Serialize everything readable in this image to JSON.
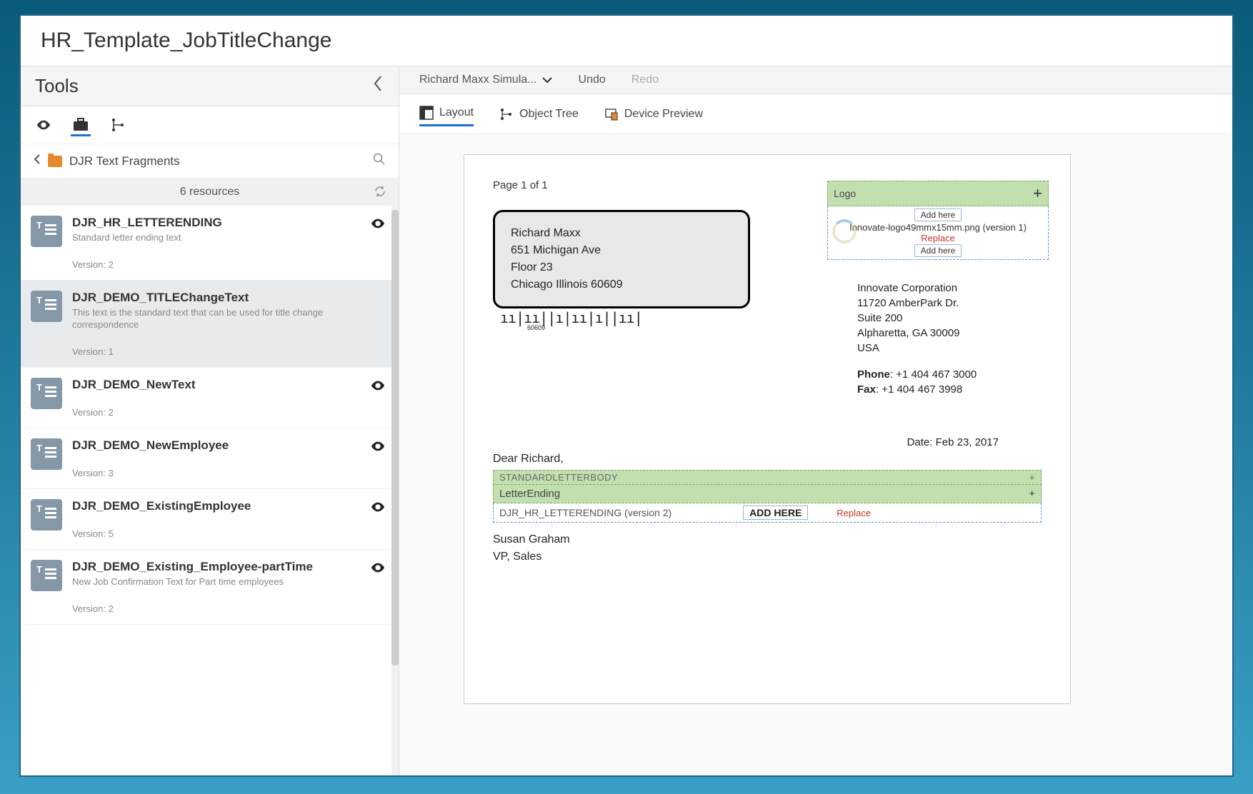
{
  "title": "HR_Template_JobTitleChange",
  "sidebar": {
    "tools_title": "Tools",
    "breadcrumb": "DJR Text Fragments",
    "count_label": "6 resources",
    "items": [
      {
        "title": "DJR_HR_LETTERENDING",
        "desc": "Standard letter ending text",
        "version": "Version: 2",
        "selected": false
      },
      {
        "title": "DJR_DEMO_TITLEChangeText",
        "desc": "This text is the standard text that can be used for title change correspondence",
        "version": "Version: 1",
        "selected": true
      },
      {
        "title": "DJR_DEMO_NewText",
        "desc": "",
        "version": "Version: 2",
        "selected": false
      },
      {
        "title": "DJR_DEMO_NewEmployee",
        "desc": "",
        "version": "Version: 3",
        "selected": false
      },
      {
        "title": "DJR_DEMO_ExistingEmployee",
        "desc": "",
        "version": "Version: 5",
        "selected": false
      },
      {
        "title": "DJR_DEMO_Existing_Employee-partTime",
        "desc": "New Job Confirmation Text for Part time employees",
        "version": "Version: 2",
        "selected": false
      }
    ]
  },
  "content": {
    "simulator": "Richard Maxx Simula...",
    "undo": "Undo",
    "redo": "Redo",
    "tabs": {
      "layout": "Layout",
      "object_tree": "Object Tree",
      "device_preview": "Device Preview"
    }
  },
  "page": {
    "page_number": "Page 1 of 1",
    "recipient": {
      "name": "Richard Maxx",
      "line1": "651 Michigan Ave",
      "line2": "Floor 23",
      "line3": "Chicago Illinois 60609"
    },
    "barcode_code": "60609",
    "logo_zone": {
      "label": "Logo",
      "add_here": "Add here",
      "filename": "Innovate-logo49mmx15mm.png (version 1)",
      "replace": "Replace"
    },
    "company": {
      "name": "Innovate Corporation",
      "line1": "11720 AmberPark Dr.",
      "line2": "Suite 200",
      "line3": "Alpharetta, GA 30009",
      "line4": "USA",
      "phone_label": "Phone",
      "phone": ": +1 404 467 3000",
      "fax_label": "Fax",
      "fax": ": +1 404 467 3998"
    },
    "date_label": "Date: Feb 23, 2017",
    "greeting": "Dear Richard,",
    "standard_body": "STANDARDLETTERBODY",
    "letter_ending_label": "LetterEnding",
    "add_here_big": "ADD HERE",
    "ending_filename": "DJR_HR_LETTERENDING (version 2)",
    "replace": "Replace",
    "signer_name": "Susan Graham",
    "signer_title": "VP, Sales"
  }
}
